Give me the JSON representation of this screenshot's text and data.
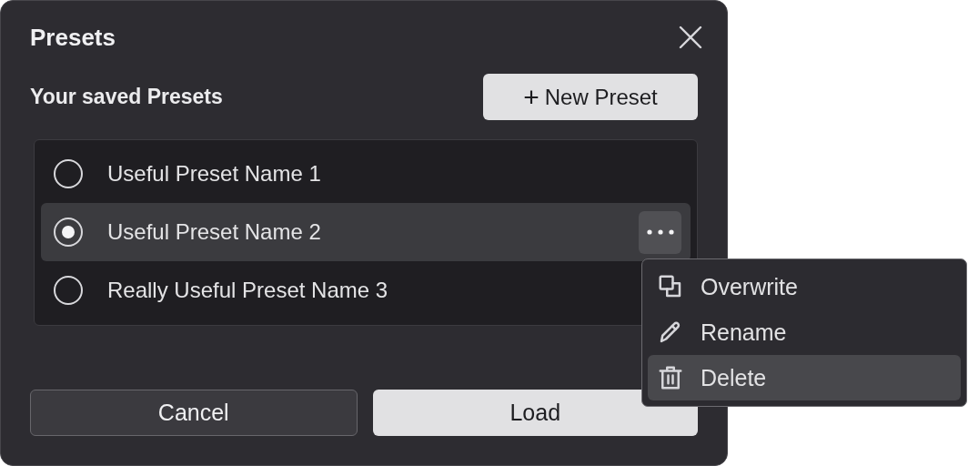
{
  "dialog": {
    "title": "Presets",
    "subtitle": "Your saved Presets",
    "new_button": {
      "icon": "+",
      "label": "New Preset"
    }
  },
  "presets": [
    {
      "name": "Useful Preset Name 1",
      "selected": false
    },
    {
      "name": "Useful Preset Name 2",
      "selected": true
    },
    {
      "name": "Really Useful Preset Name 3",
      "selected": false
    }
  ],
  "context_menu": [
    {
      "kind": "overwrite",
      "label": "Overwrite",
      "selected": false
    },
    {
      "kind": "rename",
      "label": "Rename",
      "selected": false
    },
    {
      "kind": "delete",
      "label": "Delete",
      "selected": true
    }
  ],
  "buttons": [
    {
      "kind": "secondary",
      "label": "Cancel"
    },
    {
      "kind": "primary",
      "label": "Load"
    }
  ]
}
